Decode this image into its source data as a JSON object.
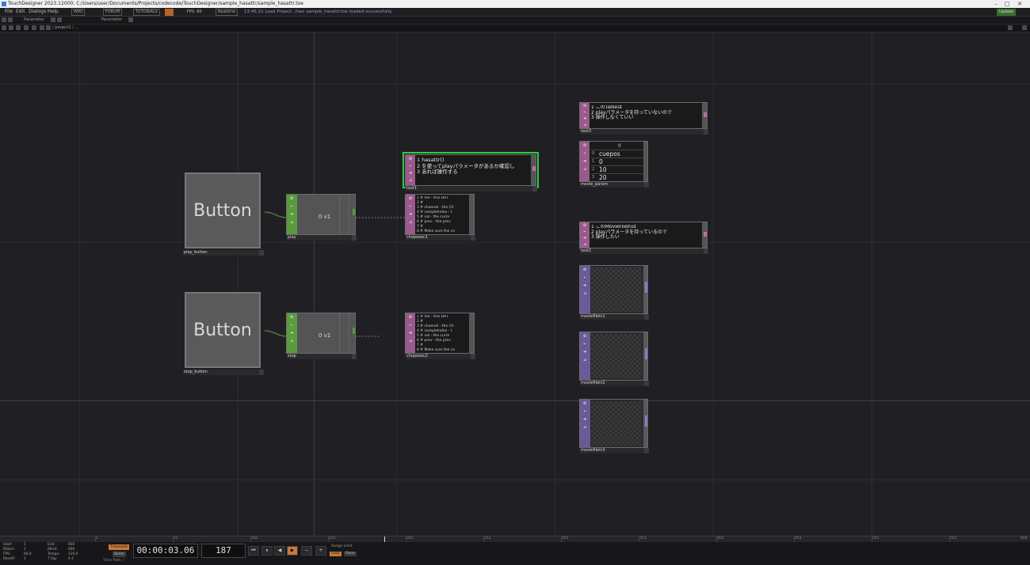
{
  "window": {
    "title": "TouchDesigner  2023.12000: C:/Users/user/Documents/Projects/codecode/TouchDesigner/sample_hasattr/sample_hasattr.toe",
    "minimize": "–",
    "maximize": "□",
    "close": "✕"
  },
  "menu": {
    "items": [
      "File",
      "Edit",
      "Dialogs",
      "Help"
    ],
    "chips": [
      "WIKI",
      "FORUM",
      "TUTORIALS"
    ],
    "fps_label": "FPS: 60",
    "realtime": "Realtime",
    "status_message": "13:45:21 Load Project: 2sec  sample_hasattr.toe loaded successfully.",
    "update": "Update"
  },
  "toolbar": {
    "panel_a": "Parameter",
    "panel_b": "Parameter"
  },
  "path": {
    "text": "/ project1 / ..."
  },
  "nodes": {
    "play_button": {
      "label": "play_button",
      "text": "Button"
    },
    "stop_button": {
      "label": "stop_button",
      "text": "Button"
    },
    "play": {
      "label": "play",
      "value": "0 v1"
    },
    "stop": {
      "label": "stop",
      "value": "0 v1"
    },
    "chopexec1": {
      "label": "chopexec1",
      "code": "1 # me - this DAT\n2 #\n3 # channel - the Ch\n4 # sampleIndex - t\n5 # val - the curre\n6 # prev - the prev\n7 #\n8 # Make sure the co"
    },
    "chopexec2": {
      "label": "chopexec2",
      "code": "1 # me - this DAT\n2 #\n3 # channel - the Ch\n4 # sampleIndex - t\n5 # val - the curre\n6 # prev - the prev\n7 #\n8 # Make sure the co"
    },
    "text1": {
      "label": "text1",
      "code": "1 hasattr()\n2 を使ってplayパラメータがあるか確認し\n3 あれば操作する"
    },
    "text3": {
      "label": "text3",
      "code": "1 このTableは\n2 playパラメータを持っていないので\n3 操作しなくていい"
    },
    "text2": {
      "label": "text2",
      "code": "1 このMovieFileInは\n2 playパラメータを持っているので\n3 操作したい"
    },
    "movie_param": {
      "label": "movie_param",
      "header": "0",
      "rows": [
        {
          "idx": "0",
          "val": "cuepos"
        },
        {
          "idx": "1",
          "val": "0"
        },
        {
          "idx": "2",
          "val": "10"
        },
        {
          "idx": "3",
          "val": "20"
        }
      ]
    },
    "moviefilein1": {
      "label": "moviefilein1"
    },
    "moviefilein2": {
      "label": "moviefilein2"
    },
    "moviefilein3": {
      "label": "moviefilein3"
    }
  },
  "timeline": {
    "ticks": [
      "1",
      "51",
      "101",
      "151",
      "201",
      "251",
      "301",
      "351",
      "401",
      "451",
      "501",
      "551",
      "600"
    ]
  },
  "bottom": {
    "stats": [
      {
        "k": "Start:",
        "v": "1",
        "k2": "End:",
        "v2": "600"
      },
      {
        "k": "RStart:",
        "v": "1",
        "k2": "REnd:",
        "v2": "600"
      },
      {
        "k": "FPS:",
        "v": "60.0",
        "k2": "Tempo:",
        "v2": "120.0"
      },
      {
        "k": "ResetF:",
        "v": "1",
        "k2": "T Sig:",
        "v2": "4    4"
      }
    ],
    "timecode_btn": "Timecode",
    "beats_btn": "Beats",
    "timecode": "00:00:03.06",
    "frame": "187",
    "range_label": "Range Limit",
    "loop": "Loop",
    "once": "Once",
    "time_path": "Time Path: /"
  },
  "colors": {
    "chop": "#5c9a3e",
    "dat": "#9b5a8d",
    "top": "#6a5a9a",
    "selected": "#2ecc40"
  }
}
